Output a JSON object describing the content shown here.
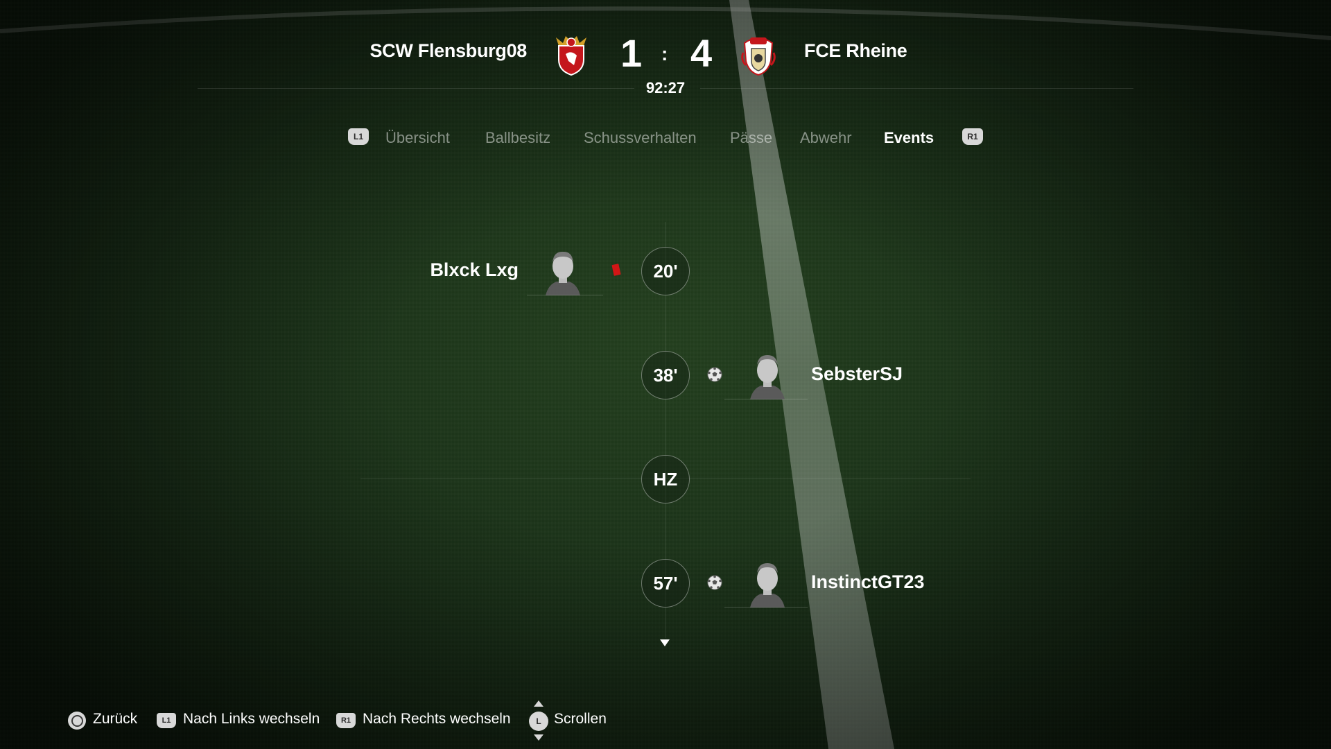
{
  "match": {
    "home_team": "SCW Flensburg08",
    "away_team": "FCE Rheine",
    "home_score": "1",
    "away_score": "4",
    "separator": ":",
    "clock": "92:27"
  },
  "tabs": {
    "left_button": "L1",
    "right_button": "R1",
    "items": [
      "Übersicht",
      "Ballbesitz",
      "Schussverhalten",
      "Pässe",
      "Abwehr",
      "Events"
    ],
    "active": "Events"
  },
  "events": [
    {
      "minute": "20'",
      "side": "home",
      "type": "red-card",
      "player": "Blxck Lxg"
    },
    {
      "minute": "38'",
      "side": "away",
      "type": "goal",
      "player": "SebsterSJ"
    },
    {
      "minute": "HZ",
      "side": "center",
      "type": "half-time",
      "player": ""
    },
    {
      "minute": "57'",
      "side": "away",
      "type": "goal",
      "player": "InstinctGT23"
    }
  ],
  "footer": {
    "back_label": "Zurück",
    "l1_badge": "L1",
    "left_label": "Nach Links wechseln",
    "r1_badge": "R1",
    "right_label": "Nach Rechts wechseln",
    "stick_badge": "L",
    "scroll_label": "Scrollen"
  },
  "colors": {
    "red_card": "#d31616",
    "home_crest": "#c4161c",
    "away_crest": "#c4161c"
  }
}
